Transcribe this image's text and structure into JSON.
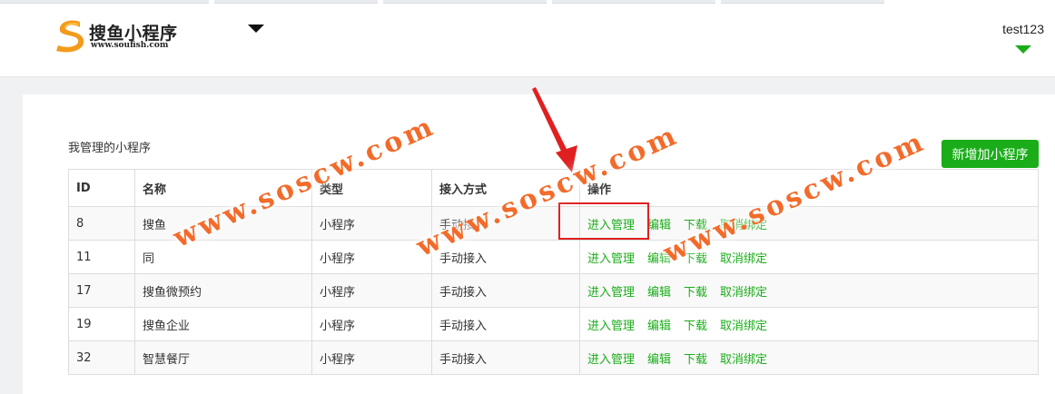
{
  "header": {
    "logo_text": "搜鱼小程序",
    "logo_url": "www.soufish.com",
    "user_name": "test123"
  },
  "main": {
    "section_title": "我管理的小程序",
    "add_button": "新增加小程序",
    "columns": [
      "ID",
      "名称",
      "类型",
      "接入方式",
      "操作"
    ],
    "rows": [
      {
        "id": "8",
        "name": "搜鱼",
        "type": "小程序",
        "access": "手动接入"
      },
      {
        "id": "11",
        "name": "同",
        "type": "小程序",
        "access": "手动接入"
      },
      {
        "id": "17",
        "name": "搜鱼微预约",
        "type": "小程序",
        "access": "手动接入"
      },
      {
        "id": "19",
        "name": "搜鱼企业",
        "type": "小程序",
        "access": "手动接入"
      },
      {
        "id": "32",
        "name": "智慧餐厅",
        "type": "小程序",
        "access": "手动接入"
      }
    ],
    "actions": {
      "manage": "进入管理",
      "edit": "编辑",
      "download": "下载",
      "unbind": "取消绑定"
    }
  },
  "watermark": "www.soscw.com",
  "colors": {
    "accent_green": "#1aad19",
    "highlight_red": "#e02020",
    "watermark_orange": "#f36b2a"
  }
}
